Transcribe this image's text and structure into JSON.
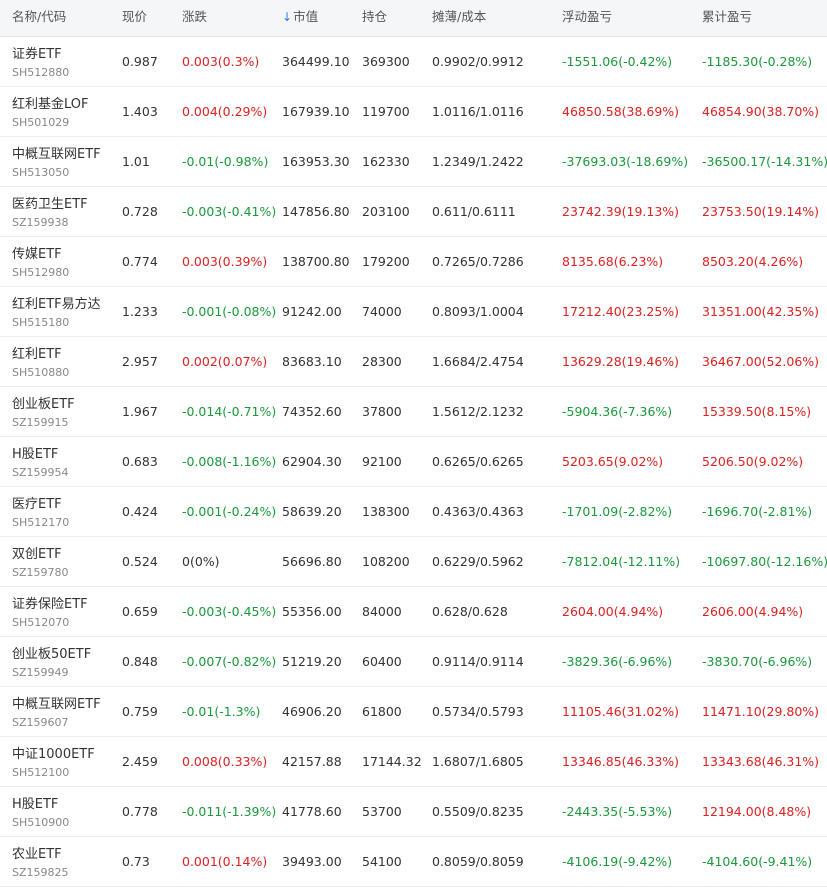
{
  "header": {
    "name": "名称/代码",
    "price": "现价",
    "change": "涨跌",
    "market_value": "市值",
    "position": "持仓",
    "cost": "摊薄/成本",
    "float_pl": "浮动盈亏",
    "total_pl": "累计盈亏",
    "sort_arrow": "↓"
  },
  "colors": {
    "up": "#e02020",
    "down": "#1a9a3a",
    "sort_arrow": "#2b7de9",
    "header_bg": "#f5f6f8"
  },
  "rows": [
    {
      "name": "证券ETF",
      "code": "SH512880",
      "price": "0.987",
      "change": "0.003(0.3%)",
      "change_dir": "up",
      "mv": "364499.10",
      "pos": "369300",
      "cost": "0.9902/0.9912",
      "float": "-1551.06(-0.42%)",
      "float_dir": "down",
      "total": "-1185.30(-0.28%)",
      "total_dir": "down"
    },
    {
      "name": "红利基金LOF",
      "code": "SH501029",
      "price": "1.403",
      "change": "0.004(0.29%)",
      "change_dir": "up",
      "mv": "167939.10",
      "pos": "119700",
      "cost": "1.0116/1.0116",
      "float": "46850.58(38.69%)",
      "float_dir": "up",
      "total": "46854.90(38.70%)",
      "total_dir": "up"
    },
    {
      "name": "中概互联网ETF",
      "code": "SH513050",
      "price": "1.01",
      "change": "-0.01(-0.98%)",
      "change_dir": "down",
      "mv": "163953.30",
      "pos": "162330",
      "cost": "1.2349/1.2422",
      "float": "-37693.03(-18.69%)",
      "float_dir": "down",
      "total": "-36500.17(-14.31%)",
      "total_dir": "down"
    },
    {
      "name": "医药卫生ETF",
      "code": "SZ159938",
      "price": "0.728",
      "change": "-0.003(-0.41%)",
      "change_dir": "down",
      "mv": "147856.80",
      "pos": "203100",
      "cost": "0.611/0.6111",
      "float": "23742.39(19.13%)",
      "float_dir": "up",
      "total": "23753.50(19.14%)",
      "total_dir": "up"
    },
    {
      "name": "传媒ETF",
      "code": "SH512980",
      "price": "0.774",
      "change": "0.003(0.39%)",
      "change_dir": "up",
      "mv": "138700.80",
      "pos": "179200",
      "cost": "0.7265/0.7286",
      "float": "8135.68(6.23%)",
      "float_dir": "up",
      "total": "8503.20(4.26%)",
      "total_dir": "up"
    },
    {
      "name": "红利ETF易方达",
      "code": "SH515180",
      "price": "1.233",
      "change": "-0.001(-0.08%)",
      "change_dir": "down",
      "mv": "91242.00",
      "pos": "74000",
      "cost": "0.8093/1.0004",
      "float": "17212.40(23.25%)",
      "float_dir": "up",
      "total": "31351.00(42.35%)",
      "total_dir": "up"
    },
    {
      "name": "红利ETF",
      "code": "SH510880",
      "price": "2.957",
      "change": "0.002(0.07%)",
      "change_dir": "up",
      "mv": "83683.10",
      "pos": "28300",
      "cost": "1.6684/2.4754",
      "float": "13629.28(19.46%)",
      "float_dir": "up",
      "total": "36467.00(52.06%)",
      "total_dir": "up"
    },
    {
      "name": "创业板ETF",
      "code": "SZ159915",
      "price": "1.967",
      "change": "-0.014(-0.71%)",
      "change_dir": "down",
      "mv": "74352.60",
      "pos": "37800",
      "cost": "1.5612/2.1232",
      "float": "-5904.36(-7.36%)",
      "float_dir": "down",
      "total": "15339.50(8.15%)",
      "total_dir": "up"
    },
    {
      "name": "H股ETF",
      "code": "SZ159954",
      "price": "0.683",
      "change": "-0.008(-1.16%)",
      "change_dir": "down",
      "mv": "62904.30",
      "pos": "92100",
      "cost": "0.6265/0.6265",
      "float": "5203.65(9.02%)",
      "float_dir": "up",
      "total": "5206.50(9.02%)",
      "total_dir": "up"
    },
    {
      "name": "医疗ETF",
      "code": "SH512170",
      "price": "0.424",
      "change": "-0.001(-0.24%)",
      "change_dir": "down",
      "mv": "58639.20",
      "pos": "138300",
      "cost": "0.4363/0.4363",
      "float": "-1701.09(-2.82%)",
      "float_dir": "down",
      "total": "-1696.70(-2.81%)",
      "total_dir": "down"
    },
    {
      "name": "双创ETF",
      "code": "SZ159780",
      "price": "0.524",
      "change": "0(0%)",
      "change_dir": "flat",
      "mv": "56696.80",
      "pos": "108200",
      "cost": "0.6229/0.5962",
      "float": "-7812.04(-12.11%)",
      "float_dir": "down",
      "total": "-10697.80(-12.16%)",
      "total_dir": "down"
    },
    {
      "name": "证券保险ETF",
      "code": "SH512070",
      "price": "0.659",
      "change": "-0.003(-0.45%)",
      "change_dir": "down",
      "mv": "55356.00",
      "pos": "84000",
      "cost": "0.628/0.628",
      "float": "2604.00(4.94%)",
      "float_dir": "up",
      "total": "2606.00(4.94%)",
      "total_dir": "up"
    },
    {
      "name": "创业板50ETF",
      "code": "SZ159949",
      "price": "0.848",
      "change": "-0.007(-0.82%)",
      "change_dir": "down",
      "mv": "51219.20",
      "pos": "60400",
      "cost": "0.9114/0.9114",
      "float": "-3829.36(-6.96%)",
      "float_dir": "down",
      "total": "-3830.70(-6.96%)",
      "total_dir": "down"
    },
    {
      "name": "中概互联网ETF",
      "code": "SZ159607",
      "price": "0.759",
      "change": "-0.01(-1.3%)",
      "change_dir": "down",
      "mv": "46906.20",
      "pos": "61800",
      "cost": "0.5734/0.5793",
      "float": "11105.46(31.02%)",
      "float_dir": "up",
      "total": "11471.10(29.80%)",
      "total_dir": "up"
    },
    {
      "name": "中证1000ETF",
      "code": "SH512100",
      "price": "2.459",
      "change": "0.008(0.33%)",
      "change_dir": "up",
      "mv": "42157.88",
      "pos": "17144.32",
      "cost": "1.6807/1.6805",
      "float": "13346.85(46.33%)",
      "float_dir": "up",
      "total": "13343.68(46.31%)",
      "total_dir": "up"
    },
    {
      "name": "H股ETF",
      "code": "SH510900",
      "price": "0.778",
      "change": "-0.011(-1.39%)",
      "change_dir": "down",
      "mv": "41778.60",
      "pos": "53700",
      "cost": "0.5509/0.8235",
      "float": "-2443.35(-5.53%)",
      "float_dir": "down",
      "total": "12194.00(8.48%)",
      "total_dir": "up"
    },
    {
      "name": "农业ETF",
      "code": "SZ159825",
      "price": "0.73",
      "change": "0.001(0.14%)",
      "change_dir": "up",
      "mv": "39493.00",
      "pos": "54100",
      "cost": "0.8059/0.8059",
      "float": "-4106.19(-9.42%)",
      "float_dir": "down",
      "total": "-4104.60(-9.41%)",
      "total_dir": "down"
    }
  ]
}
